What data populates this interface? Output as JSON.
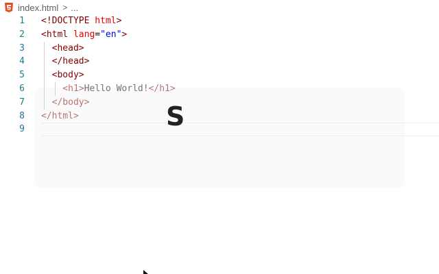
{
  "breadcrumb": {
    "file_icon": "html5-icon",
    "file_name": "index.html",
    "separator": ">",
    "more": "..."
  },
  "code_lines": [
    {
      "number": "1",
      "parts": [
        {
          "t": "<!DOCTYPE ",
          "c": "t-doc"
        },
        {
          "t": "html",
          "c": "t-attr"
        },
        {
          "t": ">",
          "c": "t-doc"
        }
      ]
    },
    {
      "number": "2",
      "parts": [
        {
          "t": "<html ",
          "c": "t-tag"
        },
        {
          "t": "lang",
          "c": "t-attr"
        },
        {
          "t": "=",
          "c": "t-text"
        },
        {
          "t": "\"en\"",
          "c": "t-str"
        },
        {
          "t": ">",
          "c": "t-tag"
        }
      ]
    },
    {
      "number": "3",
      "parts": [
        {
          "t": "  <head>",
          "c": "t-tag"
        }
      ]
    },
    {
      "number": "4",
      "parts": [
        {
          "t": "  </head>",
          "c": "t-tag"
        }
      ]
    },
    {
      "number": "5",
      "parts": [
        {
          "t": "  <body>",
          "c": "t-tag"
        }
      ]
    },
    {
      "number": "6",
      "parts": [
        {
          "t": "    <h1>",
          "c": "t-tag"
        },
        {
          "t": "Hello World!",
          "c": "t-text"
        },
        {
          "t": "</h1>",
          "c": "t-tag"
        }
      ]
    },
    {
      "number": "7",
      "parts": [
        {
          "t": "  </body>",
          "c": "t-tag"
        }
      ]
    },
    {
      "number": "8",
      "parts": [
        {
          "t": "</html>",
          "c": "t-tag"
        }
      ]
    },
    {
      "number": "9",
      "parts": []
    }
  ],
  "key_overlay": {
    "letter": "S"
  },
  "colors": {
    "line_number": "#237893",
    "tag": "#800000",
    "attribute": "#e50000",
    "string": "#0000ff",
    "html5_icon": "#e44d26"
  }
}
